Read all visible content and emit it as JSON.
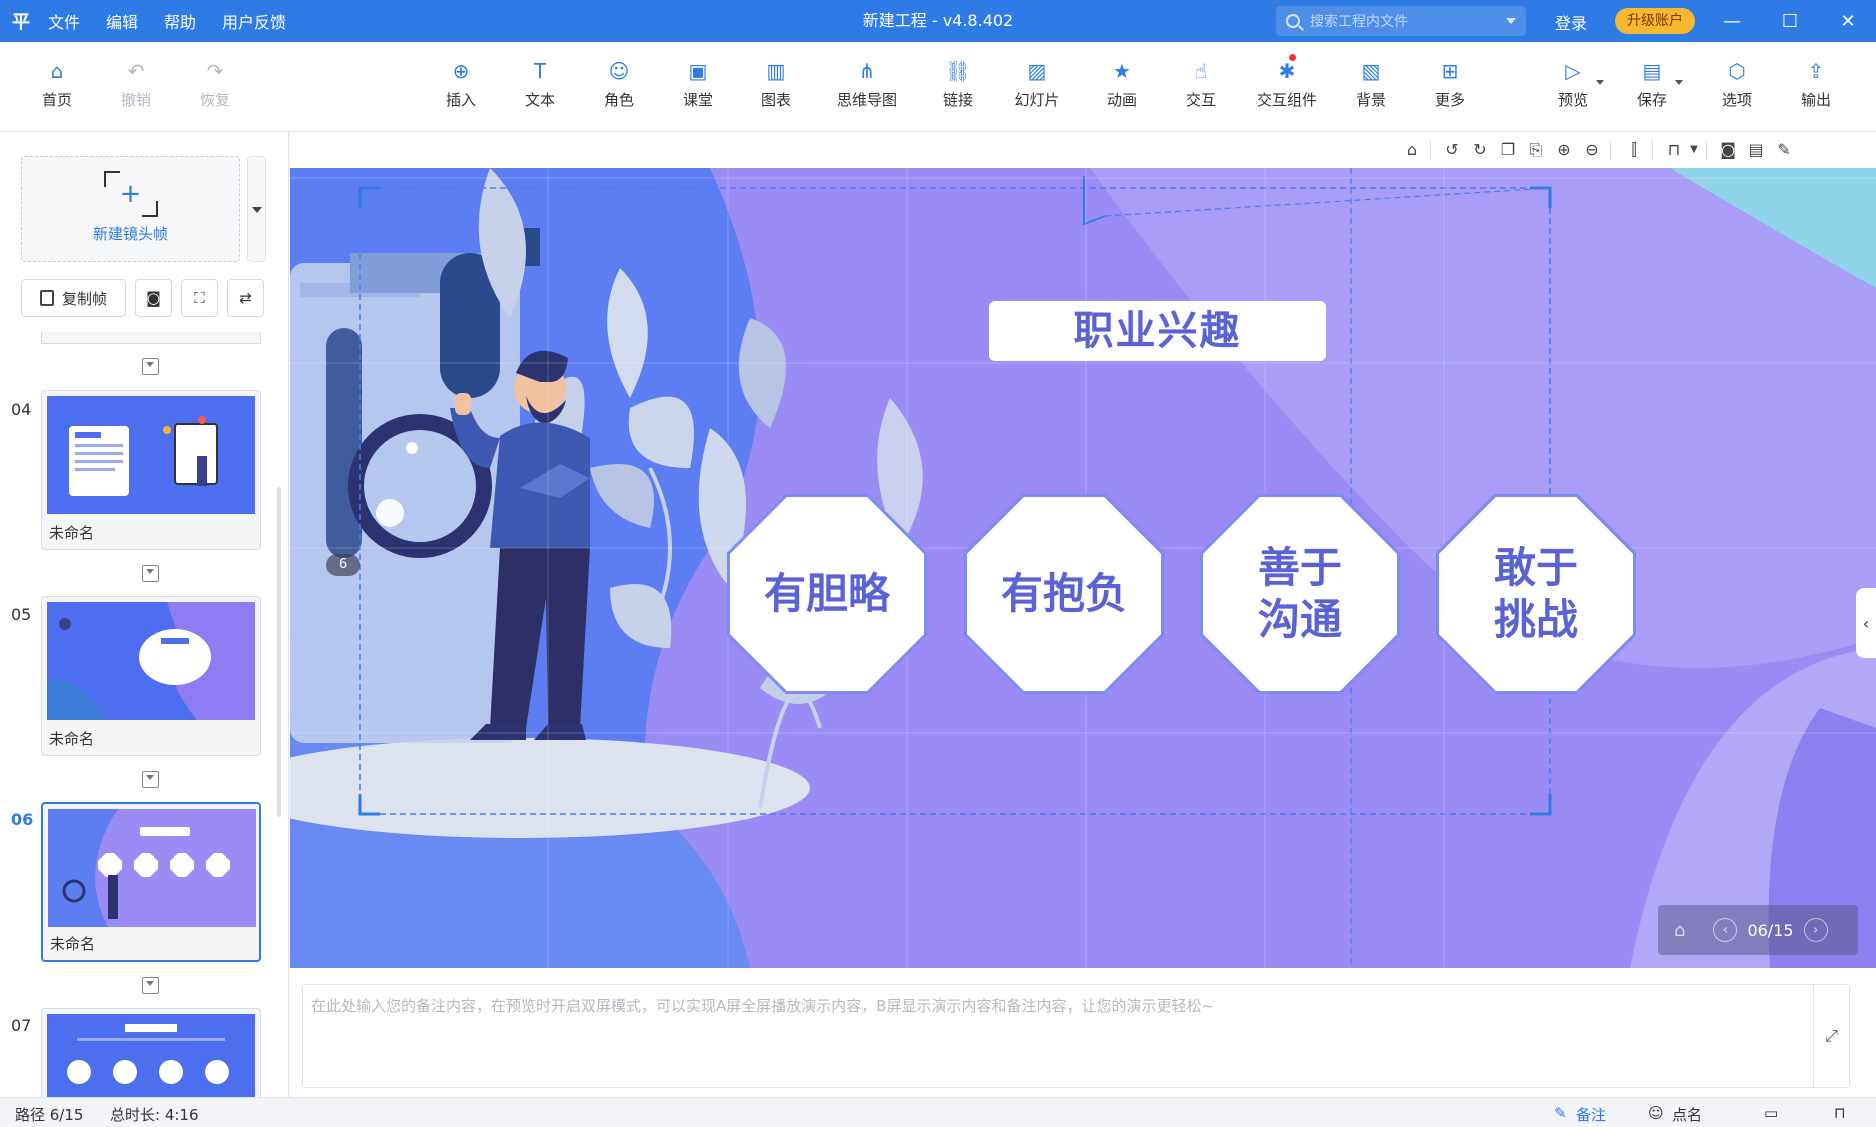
{
  "titlebar": {
    "logo": "平",
    "menu": [
      "文件",
      "编辑",
      "帮助",
      "用户反馈"
    ],
    "title": "新建工程 - v4.8.402",
    "search_placeholder": "搜索工程内文件",
    "login": "登录",
    "upgrade": "升级账户",
    "win_controls": [
      "—",
      "☐",
      "✕"
    ]
  },
  "toolbar": {
    "left": [
      {
        "label": "首页",
        "icon": "home-icon",
        "glyph": "⌂"
      },
      {
        "label": "撤销",
        "icon": "undo-icon",
        "glyph": "↶"
      },
      {
        "label": "恢复",
        "icon": "redo-icon",
        "glyph": "↷"
      }
    ],
    "center": [
      {
        "label": "插入",
        "icon": "insert-icon",
        "glyph": "⊕"
      },
      {
        "label": "文本",
        "icon": "text-icon",
        "glyph": "T"
      },
      {
        "label": "角色",
        "icon": "character-icon",
        "glyph": "☺"
      },
      {
        "label": "课堂",
        "icon": "classroom-icon",
        "glyph": "▣"
      },
      {
        "label": "图表",
        "icon": "chart-icon",
        "glyph": "▥"
      },
      {
        "label": "思维导图",
        "icon": "mindmap-icon",
        "glyph": "⋔"
      },
      {
        "label": "链接",
        "icon": "link-icon",
        "glyph": "⛓"
      },
      {
        "label": "幻灯片",
        "icon": "slides-icon",
        "glyph": "▨"
      },
      {
        "label": "动画",
        "icon": "animation-icon",
        "glyph": "★"
      },
      {
        "label": "交互",
        "icon": "interaction-icon",
        "glyph": "☝"
      },
      {
        "label": "交互组件",
        "icon": "interactive-component-icon",
        "glyph": "✱"
      },
      {
        "label": "背景",
        "icon": "background-icon",
        "glyph": "▧"
      },
      {
        "label": "更多",
        "icon": "more-icon",
        "glyph": "⊞"
      }
    ],
    "right": [
      {
        "label": "预览",
        "icon": "preview-icon",
        "glyph": "▷"
      },
      {
        "label": "保存",
        "icon": "save-icon",
        "glyph": "▤"
      },
      {
        "label": "选项",
        "icon": "options-icon",
        "glyph": "⬡"
      },
      {
        "label": "输出",
        "icon": "export-icon",
        "glyph": "⇪"
      }
    ]
  },
  "sidebar": {
    "new_frame": "新建镜头帧",
    "copy_frame": "复制帧",
    "frames": [
      {
        "num": "04",
        "name": "未命名"
      },
      {
        "num": "05",
        "name": "未命名"
      },
      {
        "num": "06",
        "name": "未命名"
      },
      {
        "num": "07",
        "name": ""
      }
    ]
  },
  "slide": {
    "title": "职业兴趣",
    "items": [
      "有胆略",
      "有抱负",
      "善于沟通",
      "敢于挑战"
    ],
    "frame_badge": "6",
    "pager": "06/15"
  },
  "notes": {
    "placeholder": "在此处输入您的备注内容，在预览时开启双屏模式，可以实现A屏全屏播放演示内容，B屏显示演示内容和备注内容，让您的演示更轻松~"
  },
  "status": {
    "path": "路径 6/15",
    "duration": "总时长: 4:16",
    "notes_btn": "备注",
    "rollcall_btn": "点名"
  },
  "colors": {
    "primary": "#2e7be6",
    "slide_text": "#5a63d6",
    "upgrade": "#f7b731"
  }
}
